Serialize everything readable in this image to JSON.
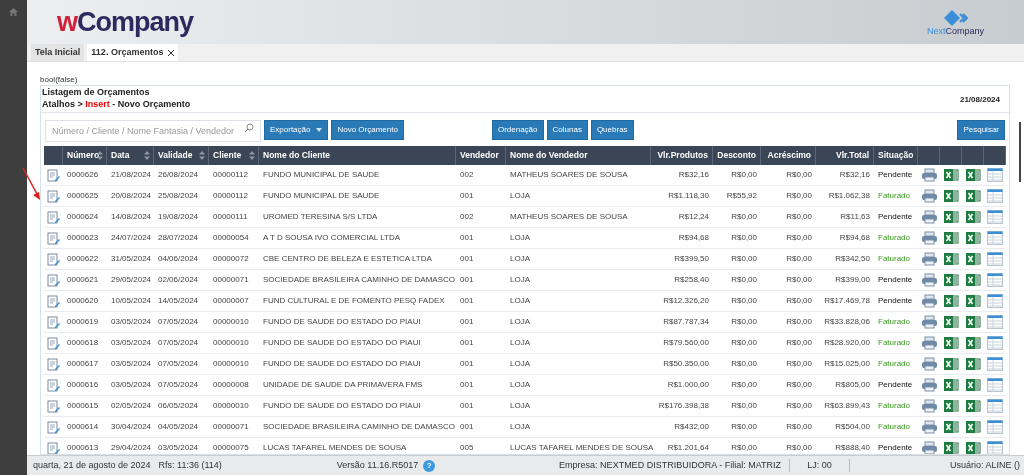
{
  "header": {
    "logo_prefix": "w",
    "logo_rest": "Company",
    "brand_prefix": "Next",
    "brand_rest": "Company"
  },
  "tabs": [
    {
      "label": "Tela Inicial",
      "selected": false,
      "closable": false
    },
    {
      "label": "112. Orçamentos",
      "selected": true,
      "closable": true
    }
  ],
  "debug_text": "bool(false)",
  "panel": {
    "title": "Listagem de Orçamentos",
    "shortcut_prefix": "Atalhos > ",
    "shortcut_key": "Insert",
    "shortcut_suffix": " - Novo Orçamento",
    "date": "21/08/2024"
  },
  "toolbar": {
    "search_placeholder": "Número / Cliente / Nome Fantasia / Vendedor",
    "export_button": "Exportação",
    "new_button": "Novo Orçamento",
    "group_buttons": [
      "Ordenação",
      "Colunas",
      "Quebras"
    ],
    "search_button": "Pesquisar"
  },
  "table": {
    "columns": [
      {
        "label": "Número",
        "sortable": true
      },
      {
        "label": "Data",
        "sortable": true
      },
      {
        "label": "Validade",
        "sortable": true
      },
      {
        "label": "Cliente",
        "sortable": true
      },
      {
        "label": "Nome do Cliente",
        "sortable": false
      },
      {
        "label": "Vendedor",
        "sortable": false
      },
      {
        "label": "Nome do Vendedor",
        "sortable": false
      },
      {
        "label": "Vlr.Produtos",
        "sortable": false
      },
      {
        "label": "Desconto",
        "sortable": false
      },
      {
        "label": "Acréscimo",
        "sortable": false
      },
      {
        "label": "Vlr.Total",
        "sortable": false
      },
      {
        "label": "Situação",
        "sortable": false
      }
    ],
    "rows": [
      {
        "cells": [
          "0000626",
          "21/08/2024",
          "26/08/2024",
          "00000112",
          "FUNDO MUNICIPAL DE SAUDE",
          "002",
          "MATHEUS SOARES DE SOUSA",
          "R$32,16",
          "R$0,00",
          "R$0,00",
          "R$32,16",
          "Pendente"
        ],
        "invoiced": false
      },
      {
        "cells": [
          "0000625",
          "20/08/2024",
          "25/08/2024",
          "00000112",
          "FUNDO MUNICIPAL DE SAUDE",
          "001",
          "LOJA",
          "R$1.118,30",
          "R$55,92",
          "R$0,00",
          "R$1.062,38",
          "Faturado"
        ],
        "invoiced": true
      },
      {
        "cells": [
          "0000624",
          "14/08/2024",
          "19/08/2024",
          "00000111",
          "UROMED TERESINA S/S LTDA",
          "002",
          "MATHEUS SOARES DE SOUSA",
          "R$12,24",
          "R$0,00",
          "R$0,00",
          "R$11,63",
          "Pendente"
        ],
        "invoiced": false
      },
      {
        "cells": [
          "0000623",
          "24/07/2024",
          "28/07/2024",
          "00000054",
          "A T D SOUSA IVO COMERCIAL LTDA",
          "001",
          "LOJA",
          "R$94,68",
          "R$0,00",
          "R$0,00",
          "R$94,68",
          "Faturado"
        ],
        "invoiced": true
      },
      {
        "cells": [
          "0000622",
          "31/05/2024",
          "04/06/2024",
          "00000072",
          "CBE CENTRO DE BELEZA E ESTETICA LTDA",
          "001",
          "LOJA",
          "R$399,50",
          "R$0,00",
          "R$0,00",
          "R$342,50",
          "Faturado"
        ],
        "invoiced": true
      },
      {
        "cells": [
          "0000621",
          "29/05/2024",
          "02/06/2024",
          "00000071",
          "SOCIEDADE BRASILEIRA CAMINHO DE DAMASCO",
          "001",
          "LOJA",
          "R$258,40",
          "R$0,00",
          "R$0,00",
          "R$399,00",
          "Pendente"
        ],
        "invoiced": false
      },
      {
        "cells": [
          "0000620",
          "10/05/2024",
          "14/05/2024",
          "00000007",
          "FUND CULTURAL E DE FOMENTO PESQ FADEX",
          "001",
          "LOJA",
          "R$12.326,20",
          "R$0,00",
          "R$0,00",
          "R$17.469,78",
          "Pendente"
        ],
        "invoiced": false
      },
      {
        "cells": [
          "0000619",
          "03/05/2024",
          "07/05/2024",
          "00000010",
          "FUNDO DE SAUDE DO ESTADO DO PIAUI",
          "001",
          "LOJA",
          "R$87.787,34",
          "R$0,00",
          "R$0,00",
          "R$33.828,06",
          "Faturado"
        ],
        "invoiced": true
      },
      {
        "cells": [
          "0000618",
          "03/05/2024",
          "07/05/2024",
          "00000010",
          "FUNDO DE SAUDE DO ESTADO DO PIAUI",
          "001",
          "LOJA",
          "R$79.560,00",
          "R$0,00",
          "R$0,00",
          "R$28.920,00",
          "Faturado"
        ],
        "invoiced": true
      },
      {
        "cells": [
          "0000617",
          "03/05/2024",
          "07/05/2024",
          "00000010",
          "FUNDO DE SAUDE DO ESTADO DO PIAUI",
          "001",
          "LOJA",
          "R$50.350,00",
          "R$0,00",
          "R$0,00",
          "R$15.025,00",
          "Faturado"
        ],
        "invoiced": true
      },
      {
        "cells": [
          "0000616",
          "03/05/2024",
          "07/05/2024",
          "00000008",
          "UNIDADE DE SAUDE DA PRIMAVERA FMS",
          "001",
          "LOJA",
          "R$1.000,00",
          "R$0,00",
          "R$0,00",
          "R$805,00",
          "Pendente"
        ],
        "invoiced": false
      },
      {
        "cells": [
          "0000615",
          "02/05/2024",
          "06/05/2024",
          "00000010",
          "FUNDO DE SAUDE DO ESTADO DO PIAUI",
          "001",
          "LOJA",
          "R$176.398,38",
          "R$0,00",
          "R$0,00",
          "R$63.899,43",
          "Faturado"
        ],
        "invoiced": true
      },
      {
        "cells": [
          "0000614",
          "30/04/2024",
          "04/05/2024",
          "00000071",
          "SOCIEDADE BRASILEIRA CAMINHO DE DAMASCO",
          "001",
          "LOJA",
          "R$432,00",
          "R$0,00",
          "R$0,00",
          "R$504,00",
          "Faturado"
        ],
        "invoiced": true
      },
      {
        "cells": [
          "0000613",
          "29/04/2024",
          "03/05/2024",
          "00000075",
          "LUCAS TAFAREL MENDES DE SOUSA",
          "005",
          "LUCAS TAFAREL MENDES DE SOUSA",
          "R$1.201,64",
          "R$0,00",
          "R$0,00",
          "R$888,40",
          "Pendente"
        ],
        "invoiced": false
      }
    ]
  },
  "status_bar": {
    "date": "quarta, 21 de agosto de 2024",
    "rfs": "Rfs: 11:36 (114)",
    "version": "Versão 11.16.R5017",
    "help": "?",
    "company": "Empresa: NEXTMED DISTRIBUIDORA - Filial: MATRIZ",
    "store": "LJ: 00",
    "user": "Usuário: ALINE ()"
  }
}
